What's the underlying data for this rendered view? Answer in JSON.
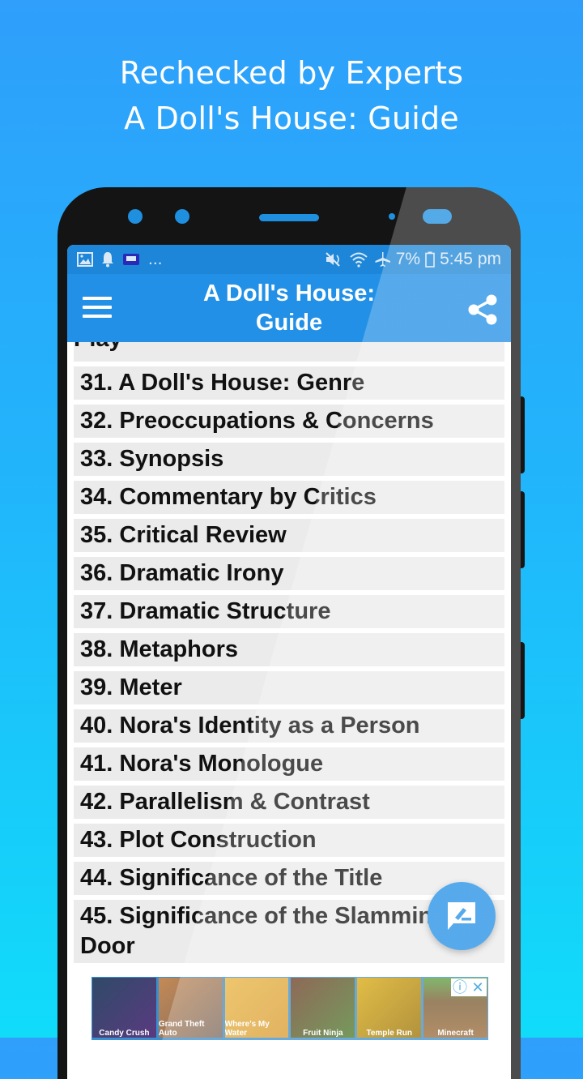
{
  "promo": {
    "line1": "Rechecked by Experts",
    "line2": "A Doll's House: Guide"
  },
  "statusbar": {
    "left_icons": [
      "image-icon",
      "bell-icon",
      "app-icon"
    ],
    "more": "...",
    "battery": "7%",
    "time": "5:45 pm",
    "right_icons": [
      "mute-icon",
      "wifi-icon",
      "airplane-icon",
      "battery-icon"
    ]
  },
  "appbar": {
    "title_line1": "A Doll's House:",
    "title_line2": "Guide",
    "menu_icon": "hamburger-menu-icon",
    "share_icon": "share-icon"
  },
  "list": {
    "partial_top": "Play",
    "items": [
      "31. A Doll's House: Genre",
      "32. Preoccupations & Concerns",
      "33. Synopsis",
      "34. Commentary by Critics",
      "35. Critical Review",
      "36. Dramatic Irony",
      "37. Dramatic Structure",
      "38. Metaphors",
      "39. Meter",
      "40. Nora's Identity as a Person",
      "41. Nora's Monologue",
      "42. Parallelism & Contrast",
      "43. Plot Construction",
      "44. Significance of the Title"
    ],
    "last_item": "45. Significance of the Slamming the Door"
  },
  "fab": {
    "icon": "feedback-edit-icon"
  },
  "ad": {
    "tiles": [
      "Candy Crush",
      "Grand Theft Auto",
      "Where's My Water",
      "Fruit Ninja",
      "Temple Run",
      "Minecraft"
    ],
    "tile_colors": [
      "#2f4a68",
      "#c58a55",
      "#e8b440",
      "#6a3a22",
      "#d8a80c",
      "#7a5a30"
    ],
    "info_label": "ⓘ",
    "close_label": "✕"
  },
  "colors": {
    "accent": "#2190e6",
    "statusbar": "#1d86d8",
    "list_item_bg": "#ebebeb"
  }
}
